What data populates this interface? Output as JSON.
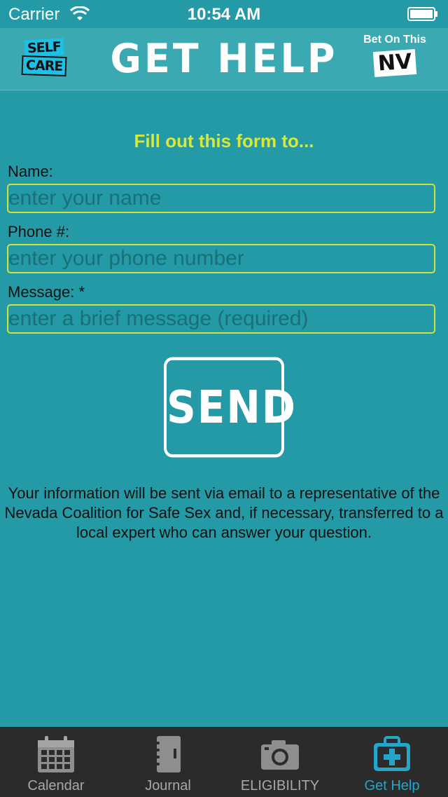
{
  "status_bar": {
    "carrier": "Carrier",
    "time": "10:54 AM"
  },
  "nav": {
    "title": "GET HELP",
    "logo_top": "SELF",
    "logo_bottom": "CARE",
    "right_text": "Bet On This",
    "right_badge": "NV"
  },
  "form": {
    "intro": "Fill out this form to...",
    "name_label": "Name:",
    "name_placeholder": "enter your name",
    "phone_label": "Phone #:",
    "phone_placeholder": "enter your phone number",
    "message_label": "Message: *",
    "message_placeholder": "enter a brief message (required)",
    "send_label": "SEND"
  },
  "info": "Your information will be sent via email to a representative of the Nevada Coalition for Safe Sex and, if necessary, transferred to a local expert who can answer your question.",
  "tabs": [
    {
      "label": "Calendar",
      "icon": "calendar-icon"
    },
    {
      "label": "Journal",
      "icon": "journal-icon"
    },
    {
      "label": "ELIGIBILITY",
      "icon": "camera-icon"
    },
    {
      "label": "Get Help",
      "icon": "medical-kit-icon",
      "active": true
    }
  ],
  "colors": {
    "background": "#239aa5",
    "accent": "#d8e83a",
    "tab_active": "#23a6c8"
  }
}
